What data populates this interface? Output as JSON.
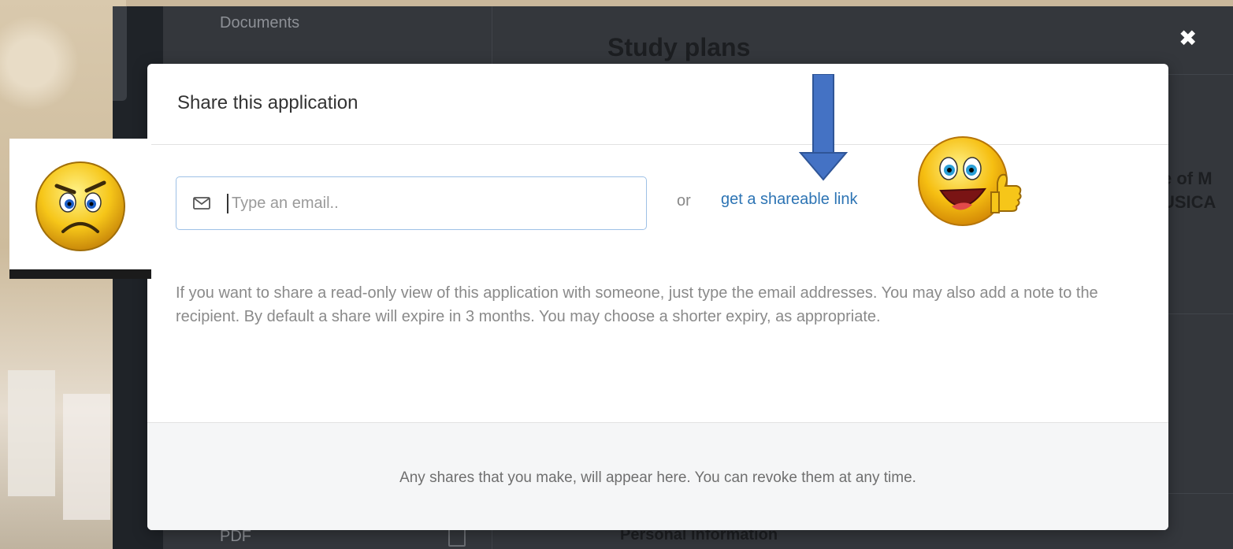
{
  "background_app": {
    "nav_items": [
      {
        "label": "Documents"
      },
      {
        "label": "PDF"
      }
    ],
    "main_title": "Study plans",
    "peek_texts": [
      "e of M",
      "USICA"
    ],
    "section_title": "Personal information"
  },
  "modal": {
    "title": "Share this application",
    "email_placeholder": "Type an email..",
    "or_label": "or",
    "share_link_label": "get a shareable link",
    "help_text": "If you want to share a read-only view of this application with someone, just type the email addresses. You may also add a note to the recipient. By default a share will expire in 3 months. You may choose a shorter expiry, as appropriate.",
    "footer_text": "Any shares that you make, will appear here. You can revoke them at any time."
  },
  "icons": {
    "close": "close-icon",
    "mail": "mail-icon",
    "arrow": "arrow-down-icon",
    "sad_emoji": "frowning-emoji-icon",
    "happy_emoji": "thumbs-up-emoji-icon"
  },
  "colors": {
    "link": "#2d74b4",
    "arrow": "#4472c4",
    "input_border": "#9ec1e6",
    "overlay_dark": "#2b2e33"
  }
}
